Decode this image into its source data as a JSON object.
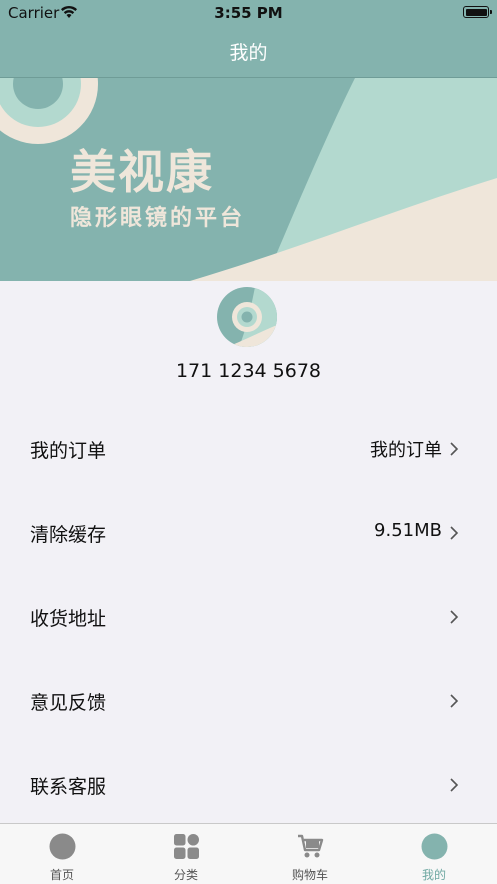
{
  "status_bar": {
    "carrier": "Carrier",
    "time": "3:55 PM"
  },
  "nav": {
    "title": "我的"
  },
  "banner": {
    "title": "美视康",
    "subtitle": "隐形眼镜的平台"
  },
  "profile": {
    "phone": "171 1234 5678"
  },
  "menu": {
    "items": [
      {
        "label": "我的订单",
        "value": "我的订单"
      },
      {
        "label": "清除缓存",
        "value": "9.51MB"
      },
      {
        "label": "收货地址",
        "value": ""
      },
      {
        "label": "意见反馈",
        "value": ""
      },
      {
        "label": "联系客服",
        "value": ""
      }
    ]
  },
  "tabbar": {
    "tabs": [
      {
        "label": "首页",
        "icon": "home-icon"
      },
      {
        "label": "分类",
        "icon": "category-grid-icon"
      },
      {
        "label": "购物车",
        "icon": "shopping-cart-icon"
      },
      {
        "label": "我的",
        "icon": "profile-icon"
      }
    ],
    "active_index": 3
  },
  "colors": {
    "accent": "#84b3ae",
    "banner_light": "#b3d9cf",
    "banner_cream": "#efe6da",
    "active_tab": "#6fa8a2"
  }
}
